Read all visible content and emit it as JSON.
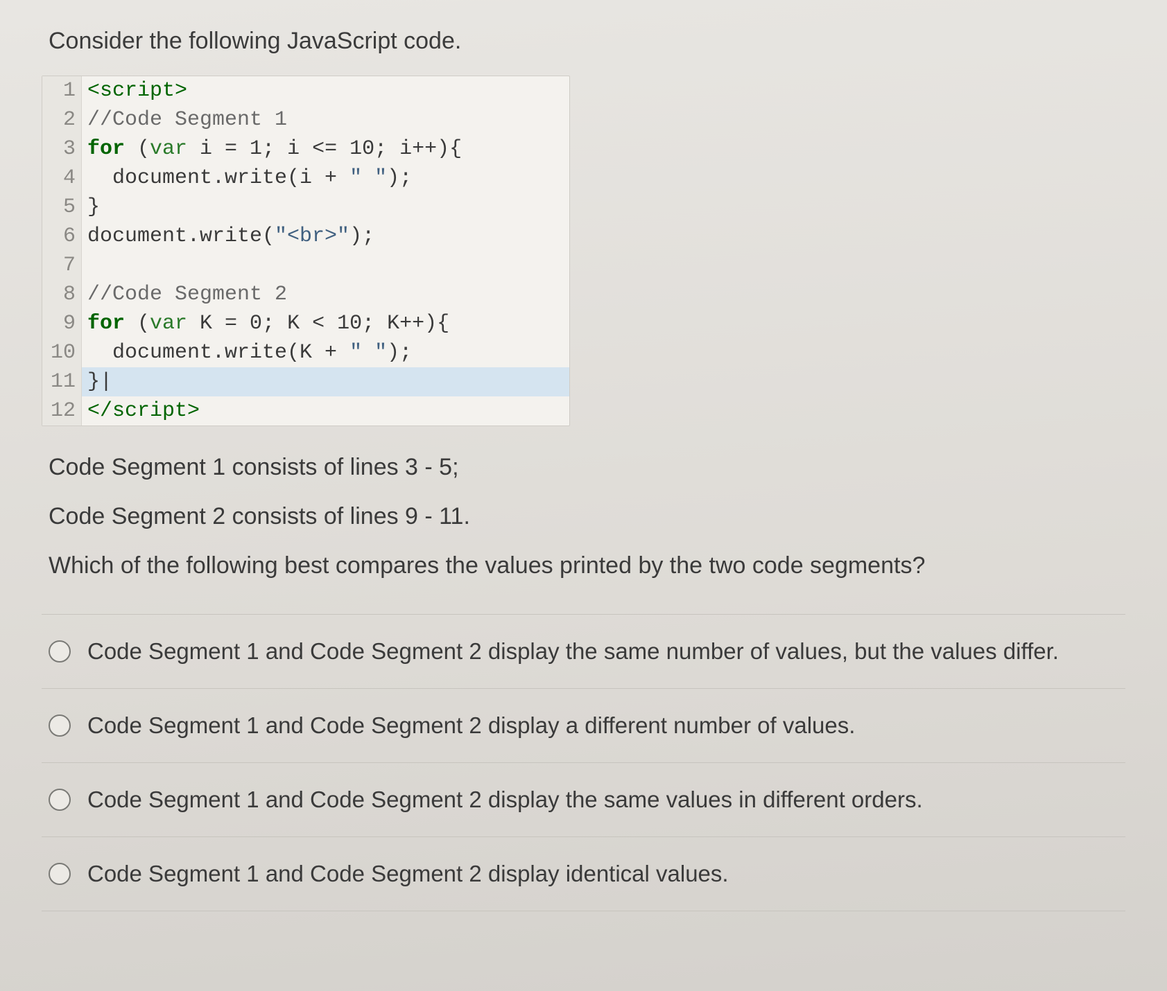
{
  "intro": "Consider the following JavaScript code.",
  "code": {
    "lines": [
      {
        "n": "1",
        "html": "<span class='tok-tag'>&lt;script&gt;</span>"
      },
      {
        "n": "2",
        "html": "<span class='tok-cmt'>//Code Segment 1</span>"
      },
      {
        "n": "3",
        "html": "<span class='tok-kw tok-bold'>for</span> (<span class='tok-kw2'>var</span> i = 1; i &lt;= 10; i++){"
      },
      {
        "n": "4",
        "html": "  document.write(i + <span class='tok-str'>\" \"</span>);"
      },
      {
        "n": "5",
        "html": "}"
      },
      {
        "n": "6",
        "html": "document.write(<span class='tok-str'>\"&lt;br&gt;\"</span>);"
      },
      {
        "n": "7",
        "html": ""
      },
      {
        "n": "8",
        "html": "<span class='tok-cmt'>//Code Segment 2</span>"
      },
      {
        "n": "9",
        "html": "<span class='tok-kw tok-bold'>for</span> (<span class='tok-kw2'>var</span> K = 0; K &lt; 10; K++){"
      },
      {
        "n": "10",
        "html": "  document.write(K + <span class='tok-str'>\" \"</span>);"
      },
      {
        "n": "11",
        "html": "}<span class='cursor-bar'>|</span>",
        "hl": true
      },
      {
        "n": "12",
        "html": "<span class='tok-tag'>&lt;/script&gt;</span>"
      }
    ]
  },
  "desc1": "Code Segment 1 consists of lines 3 - 5;",
  "desc2": "Code Segment 2 consists of lines 9 - 11.",
  "question": "Which of the following best compares the values printed by the two code segments?",
  "options": [
    "Code Segment 1 and Code Segment 2 display the same number of values, but the values differ.",
    "Code Segment 1 and Code Segment 2 display a different number of values.",
    "Code Segment 1 and Code Segment 2 display the same values in different orders.",
    "Code Segment 1 and Code Segment 2 display identical values."
  ]
}
